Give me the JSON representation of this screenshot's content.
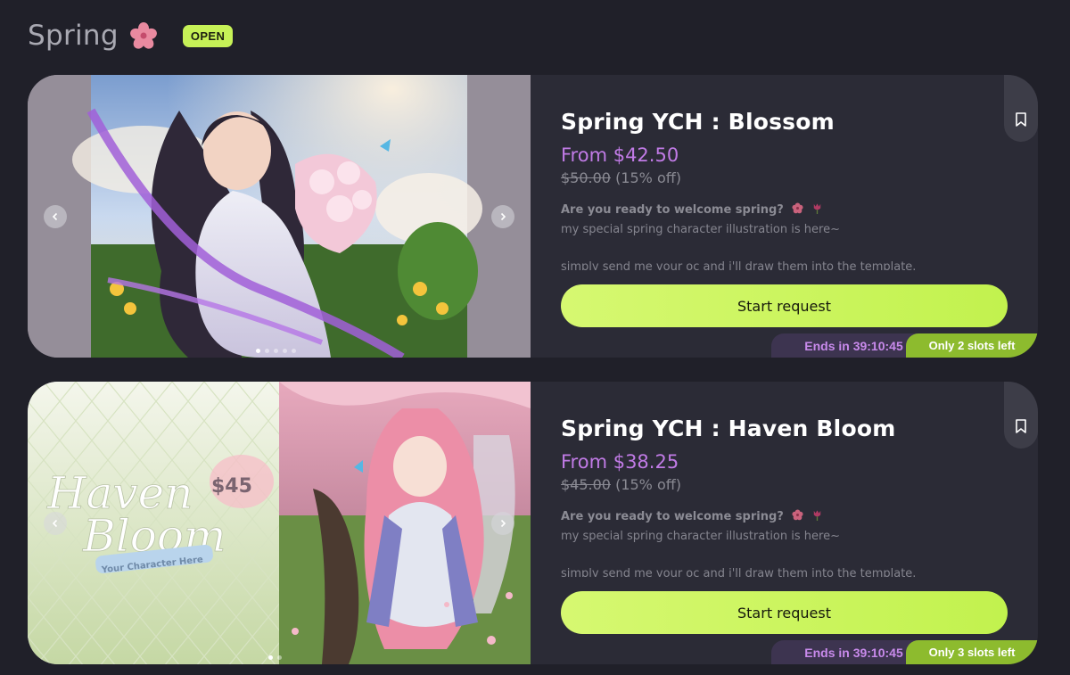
{
  "section": {
    "title": "Spring",
    "status_badge": "OPEN",
    "icon": "cherry-blossom-icon"
  },
  "colors": {
    "background": "#202029",
    "card": "#2b2b36",
    "accent_green": "#c6f157",
    "price_purple": "#c17be6"
  },
  "listings": [
    {
      "title": "Spring YCH : Blossom",
      "price": "From $42.50",
      "old_price": "$50.00",
      "discount": "(15% off)",
      "desc_heading": "Are you ready to welcome spring?",
      "desc_line2": "my special spring character illustration is here~",
      "desc_line3": "simply send me your oc and i'll draw them into the template.",
      "cta": "Start request",
      "ends": "Ends in 39:10:45",
      "slots": "Only 2 slots left",
      "carousel_slides": 5,
      "carousel_active": 1
    },
    {
      "title": "Spring YCH : Haven Bloom",
      "price": "From $38.25",
      "old_price": "$45.00",
      "discount": "(15% off)",
      "desc_heading": "Are you ready to welcome spring?",
      "desc_line2": "my special spring character illustration is here~",
      "desc_line3": "simply send me your oc and i'll draw them into the template.",
      "cta": "Start request",
      "ends": "Ends in 39:10:45",
      "slots": "Only 3 slots left",
      "carousel_slides": 2,
      "carousel_active": 1,
      "image_text": {
        "name_line1": "Haven",
        "name_line2": "Bloom",
        "price_tag": "$45",
        "caption": "Your Character Here"
      }
    }
  ]
}
